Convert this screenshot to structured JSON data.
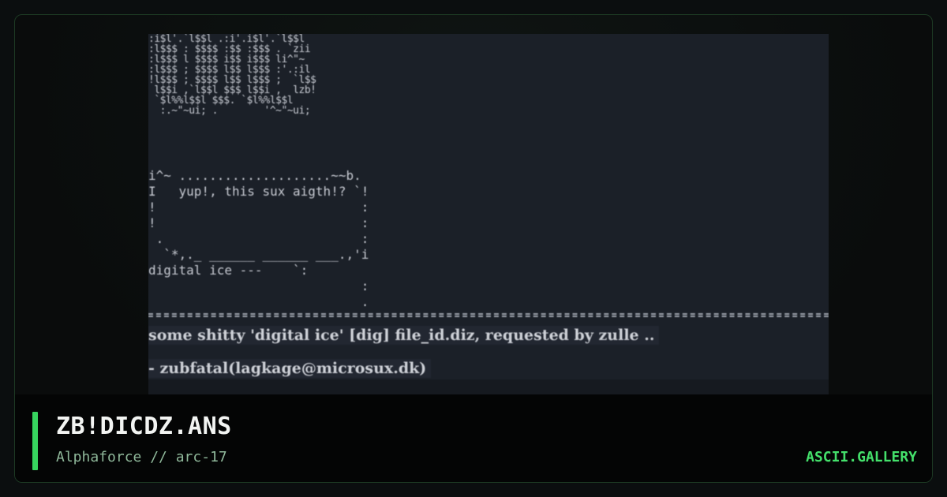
{
  "card": {
    "title": "ZB!DICDZ.ANS",
    "subtitle": "Alphaforce // arc-17",
    "brand": "ASCII.GALLERY",
    "accent_color": "#37d45f"
  },
  "artwork": {
    "logo_text": ":i$l'.`l$$l .:i'.i$l'.`l$$l\n:l$$$ : $$$$ :$$ :$$$ . `zii\n:l$$$ l $$$$ i$$ i$$$ li^\"~\n:l$$$ ; $$$$ l$$ l$$$ :'.:il\n!l$$$ ; $$$$ l$$ l$$$ ;  `l$$\n l$$i ,`l$$l $$$ l$$i ,  lzb!\n `$l%%l$$l $$$. `$l%%l$$l\n  :.~\"~ui; .        '^~\"~ui;",
    "box_text": "i^~ ....................~~b.\nI   yup!, this sux aigth!? `!\n!                           :\n!                           :\n .                          :\n  `*,._ ______ ______ ___.,'i\ndigital ice ---    `:\n                            :\n                            .",
    "greeting": "yup!, this sux aigth!?",
    "wordmark": "d i g i t a l   i c e",
    "description": "some shitty 'digital ice' [dig] file_id.diz, requested by zulle ..",
    "signature": "- zubfatal(lagkage@microsux.dk)"
  }
}
